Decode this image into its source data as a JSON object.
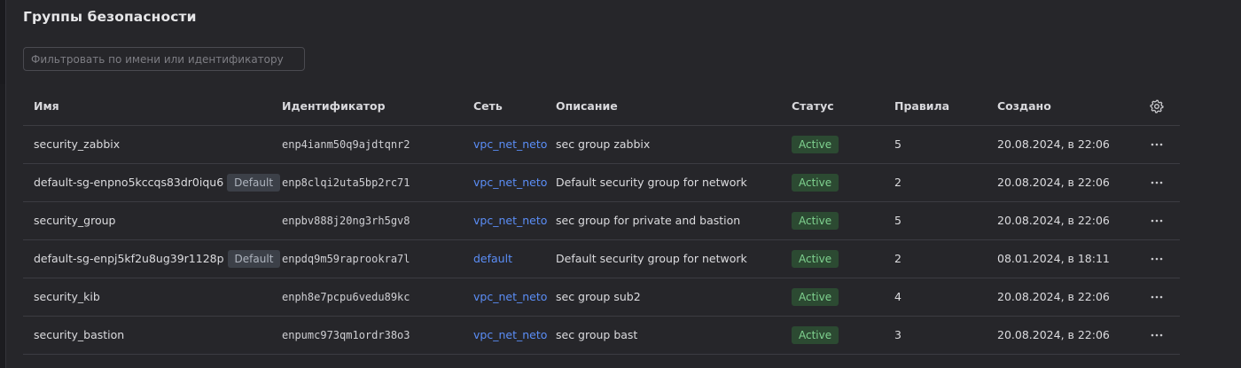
{
  "page": {
    "title": "Группы безопасности"
  },
  "filter": {
    "placeholder": "Фильтровать по имени или идентификатору",
    "value": ""
  },
  "table": {
    "columns": {
      "name": "Имя",
      "id": "Идентификатор",
      "network": "Сеть",
      "description": "Описание",
      "status": "Статус",
      "rules": "Правила",
      "created": "Создано"
    },
    "settings_icon": "gear-icon",
    "row_menu_icon": "more-horizontal-icon",
    "rows": [
      {
        "name": "security_zabbix",
        "badge": "",
        "id": "enp4ianm50q9ajdtqnr2",
        "network": "vpc_net_neto",
        "description": "sec group zabbix",
        "status": "Active",
        "rules": "5",
        "created": "20.08.2024, в 22:06"
      },
      {
        "name": "default-sg-enpno5kccqs83dr0iqu6",
        "badge": "Default",
        "id": "enp8clqi2uta5bp2rc71",
        "network": "vpc_net_neto",
        "description": "Default security group for network",
        "status": "Active",
        "rules": "2",
        "created": "20.08.2024, в 22:06"
      },
      {
        "name": "security_group",
        "badge": "",
        "id": "enpbv888j20ng3rh5gv8",
        "network": "vpc_net_neto",
        "description": "sec group for private and bastion",
        "status": "Active",
        "rules": "5",
        "created": "20.08.2024, в 22:06"
      },
      {
        "name": "default-sg-enpj5kf2u8ug39r1128p",
        "badge": "Default",
        "id": "enpdq9m59raprookra7l",
        "network": "default",
        "description": "Default security group for network",
        "status": "Active",
        "rules": "2",
        "created": "08.01.2024, в 18:11"
      },
      {
        "name": "security_kib",
        "badge": "",
        "id": "enph8e7pcpu6vedu89kc",
        "network": "vpc_net_neto",
        "description": "sec group sub2",
        "status": "Active",
        "rules": "4",
        "created": "20.08.2024, в 22:06"
      },
      {
        "name": "security_bastion",
        "badge": "",
        "id": "enpumc973qm1ordr38o3",
        "network": "vpc_net_neto",
        "description": "sec group bast",
        "status": "Active",
        "rules": "3",
        "created": "20.08.2024, в 22:06"
      }
    ]
  },
  "colors": {
    "background": "#26262a",
    "link": "#5b8ef7",
    "status_active_bg": "#2c4a32",
    "status_active_text": "#7fd28f",
    "default_badge_bg": "#3c4048"
  }
}
